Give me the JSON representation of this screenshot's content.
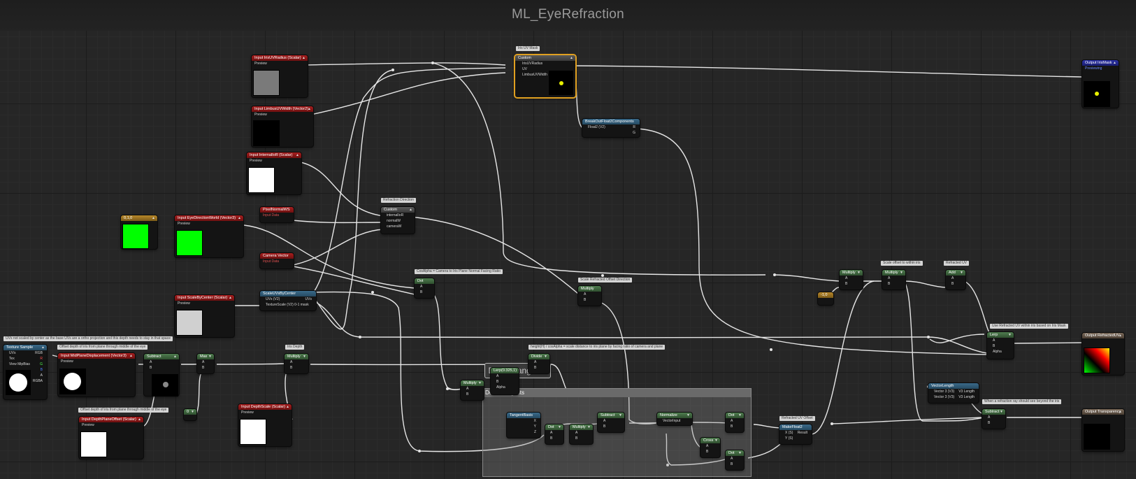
{
  "title": "ML_EyeRefraction",
  "group": {
    "title": "Derive tangents",
    "bubble": "Derive tangents"
  },
  "colors": {
    "background": "#262626",
    "wire": "#e6e6e6",
    "selected_outline": "#e0a020",
    "input_header": "#a81f1f",
    "math_header": "#4f7d4f",
    "output_header": "#2c32a8"
  },
  "comments": [
    {
      "id": "c1",
      "text": "Iris UV Mask"
    },
    {
      "id": "c2",
      "text": "Refraction Direction"
    },
    {
      "id": "c3",
      "text": "CosAlpha = Camera to Iris Plane Normal Facing Ratio"
    },
    {
      "id": "c4",
      "text": "Scale Refracted Offset Direction"
    },
    {
      "id": "c5",
      "text": "Scale offset to within iris"
    },
    {
      "id": "c6",
      "text": "Refracted UV"
    },
    {
      "id": "c7",
      "text": "Use Refracted UV within iris based on Iris Mask"
    },
    {
      "id": "c8",
      "text": "UVs not scaled by center as the base UVs are a ortho projection and this depth needs to stay in that space"
    },
    {
      "id": "c9",
      "text": "Offset depth of iris from plane through middle of the eye"
    },
    {
      "id": "c10",
      "text": "Iris Depth"
    },
    {
      "id": "c11",
      "text": "height(H) / cosAlpha = scale distance to iris plane by facing ratio of camera and plane"
    },
    {
      "id": "c12",
      "text": "Offset depth of iris from plane through middle of the eye"
    },
    {
      "id": "c13",
      "text": "Refracted UV Offset"
    },
    {
      "id": "c14",
      "text": "When a refraction ray should see beyond the iris"
    }
  ],
  "nodes": {
    "iris_uv_radius": {
      "title": "Input IrisUVRadius (Scalar)",
      "pins": [
        "Preview"
      ]
    },
    "limbus_uv_width": {
      "title": "Input LimbusUVWidth (Vector2)",
      "pins": [
        "Preview"
      ]
    },
    "internal_ior": {
      "title": "Input InternalIoR (Scalar)",
      "pins": [
        "Preview"
      ]
    },
    "const_010": {
      "title": "0,1,0"
    },
    "eye_direction": {
      "title": "Input EyeDirectionWorld (Vector3)",
      "pins": [
        "Preview"
      ]
    },
    "pixel_normal": {
      "title": "PixelNormalWS",
      "sub": "Input Data"
    },
    "camera_vector": {
      "title": "Camera Vector",
      "sub": "Input Data"
    },
    "scale_center": {
      "title": "Input ScaleByCenter (Scalar)",
      "pins": [
        "Preview"
      ]
    },
    "scale_uvs": {
      "title": "ScaleUVsByCenter",
      "pins": [
        "UVs (V2)",
        "TextureScale (V2) 0-1 mask",
        "UVs"
      ]
    },
    "custom_uv": {
      "title": "Custom",
      "pins": [
        "IrisUVRadius",
        "UV",
        "LimbusUVWidth"
      ]
    },
    "breakout": {
      "title": "BreakOutFloat2Components",
      "pins": [
        "Float2 (V2)",
        "R",
        "G"
      ]
    },
    "output_iris_mask": {
      "title": "Output IrisMask",
      "sub": "Previewing"
    },
    "custom_refr": {
      "title": "Custom",
      "pins": [
        "internalIoR",
        "normalW",
        "cameraW"
      ]
    },
    "dot1": {
      "title": "Dot",
      "pins": [
        "A",
        "B"
      ]
    },
    "multiply_scale": {
      "title": "Multiply",
      "pins": [
        "A",
        "B"
      ]
    },
    "multiply_a": {
      "title": "Multiply",
      "pins": [
        "A",
        "B"
      ]
    },
    "multiply_b": {
      "title": "Multiply",
      "pins": [
        "A",
        "B"
      ]
    },
    "const_neg1": {
      "title": "-1,0"
    },
    "add_uv": {
      "title": "Add",
      "pins": [
        "A",
        "B"
      ]
    },
    "lerp_out": {
      "title": "Lerp",
      "pins": [
        "A",
        "B",
        "Alpha"
      ]
    },
    "output_refracted_uv": {
      "title": "Output RefractedUV"
    },
    "texture_sample": {
      "title": "Texture Sample",
      "pins": [
        "UVs",
        "Tex",
        "View MipBias",
        "RGB",
        "R",
        "G",
        "B",
        "A",
        "RGBA"
      ]
    },
    "mid_plane": {
      "title": "Input MidPlaneDisplacement (Vector3)",
      "pins": [
        "Preview"
      ]
    },
    "subtract1": {
      "title": "Subtract",
      "pins": [
        "A",
        "B"
      ]
    },
    "max1": {
      "title": "Max",
      "pins": [
        "A",
        "B"
      ]
    },
    "const_0": {
      "title": "0"
    },
    "depth_offset": {
      "title": "Input DepthPlaneOffset (Scalar)",
      "pins": [
        "Preview"
      ]
    },
    "multiply_depth": {
      "title": "Multiply",
      "pins": [
        "A",
        "B"
      ]
    },
    "depth_scale": {
      "title": "Input DepthScale (Scalar)",
      "pins": [
        "Preview"
      ]
    },
    "divide1": {
      "title": "Divide",
      "pins": [
        "A",
        "B"
      ]
    },
    "lerp_0325": {
      "title": "Lerp(0.325,1)",
      "pins": [
        "A",
        "B",
        "Alpha"
      ]
    },
    "multiply_small": {
      "title": "Multiply",
      "pins": [
        "A",
        "B"
      ]
    },
    "tangent_basis": {
      "title": "TangentBasis",
      "pins": [
        "X",
        "Y",
        "Z"
      ]
    },
    "dot2": {
      "title": "Dot",
      "pins": [
        "A",
        "B"
      ]
    },
    "multiply_t": {
      "title": "Multiply",
      "pins": [
        "A",
        "B"
      ]
    },
    "subtract_t": {
      "title": "Subtract",
      "pins": [
        "A",
        "B"
      ]
    },
    "normalize1": {
      "title": "Normalize",
      "pins": [
        "VectorInput"
      ]
    },
    "cross1": {
      "title": "Cross",
      "pins": [
        "A",
        "B"
      ]
    },
    "dot3": {
      "title": "Dot",
      "pins": [
        "A",
        "B"
      ]
    },
    "dot4": {
      "title": "Dot",
      "pins": [
        "A",
        "B"
      ]
    },
    "make_float2": {
      "title": "MakeFloat2",
      "pins": [
        "X (S)",
        "Result",
        "Y (S)"
      ]
    },
    "vector_length": {
      "title": "VectorLength",
      "pins": [
        "Vector 3 (V3)",
        "V3 Length",
        "Vector 3 (V3)",
        "V3 Length"
      ]
    },
    "subtract_len": {
      "title": "Subtract",
      "pins": [
        "A",
        "B"
      ]
    },
    "output_transparency": {
      "title": "Output Transparency"
    }
  }
}
